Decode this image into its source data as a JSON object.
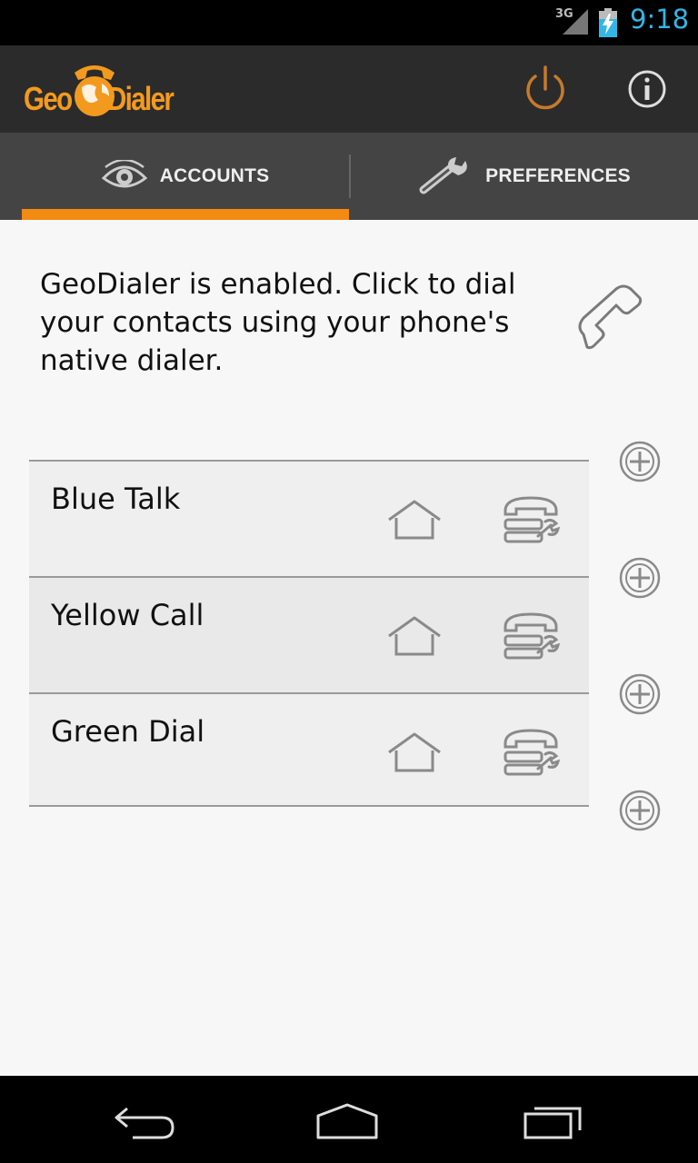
{
  "status_bar": {
    "network": "3G",
    "time": "9:18",
    "icons": [
      "signal-icon",
      "battery-charging-icon"
    ]
  },
  "app": {
    "logo_left": "Geo",
    "logo_right": "Dialer",
    "actions": [
      "power-icon",
      "info-icon"
    ],
    "colors": {
      "accent": "#f38a12",
      "action_bar": "#2b2b2b",
      "tab_bar": "#444444",
      "clock": "#33b5e5"
    }
  },
  "tabs": [
    {
      "label": "ACCOUNTS",
      "icon": "eye-icon",
      "selected": true
    },
    {
      "label": "PREFERENCES",
      "icon": "wrench-icon",
      "selected": false
    }
  ],
  "main": {
    "status_message": "GeoDialer is enabled. Click to dial your contacts using your phone's native dialer.",
    "accounts": [
      {
        "name": "Blue Talk"
      },
      {
        "name": "Yellow Call"
      },
      {
        "name": "Green Dial"
      }
    ]
  },
  "nav_bar": {
    "buttons": [
      "back-icon",
      "home-icon",
      "recent-apps-icon"
    ]
  }
}
